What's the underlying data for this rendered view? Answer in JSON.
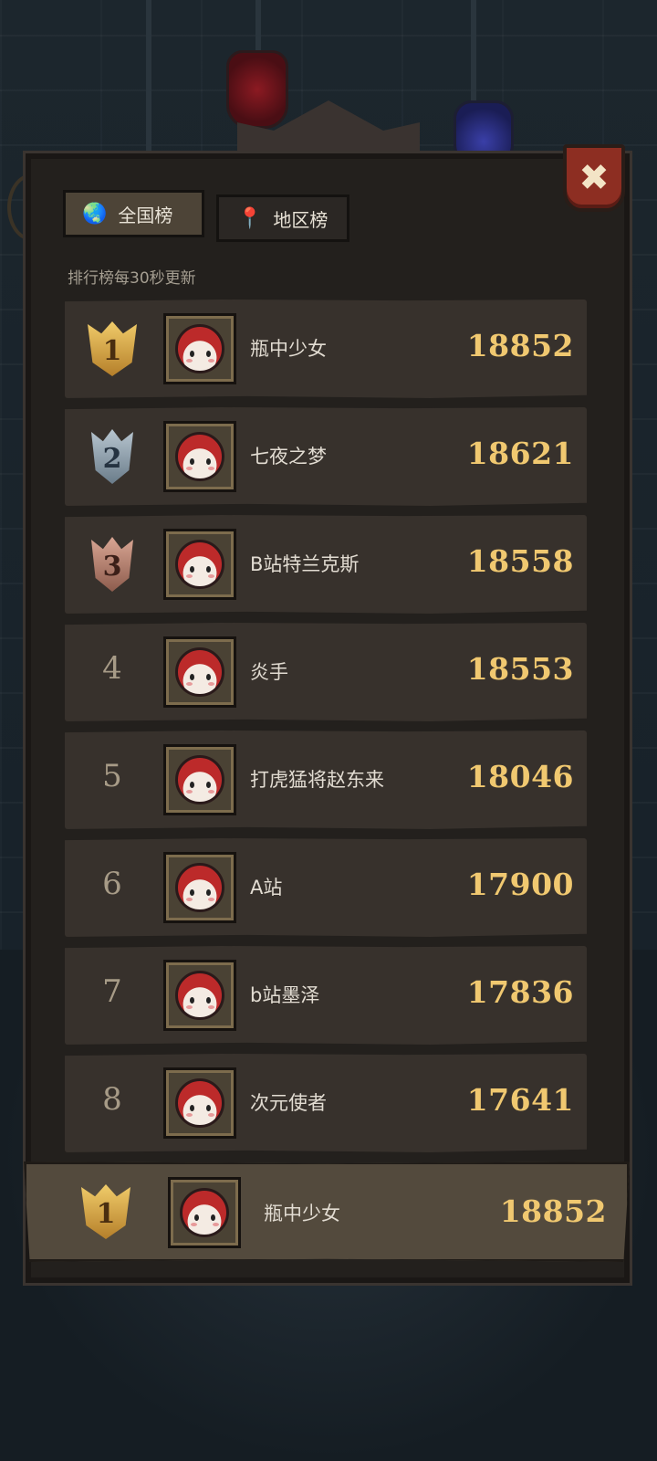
{
  "tabs": [
    {
      "label": "全国榜",
      "icon": "globe-icon",
      "selected": true
    },
    {
      "label": "地区榜",
      "icon": "location-pin-icon",
      "selected": false
    }
  ],
  "subtitle": "排行榜每30秒更新",
  "close_icon": "close-icon",
  "rows": [
    {
      "rank": "1",
      "name": "瓶中少女",
      "score": "18852"
    },
    {
      "rank": "2",
      "name": "七夜之梦",
      "score": "18621"
    },
    {
      "rank": "3",
      "name": "B站特兰克斯",
      "score": "18558"
    },
    {
      "rank": "4",
      "name": "炎手",
      "score": "18553"
    },
    {
      "rank": "5",
      "name": "打虎猛将赵东来",
      "score": "18046"
    },
    {
      "rank": "6",
      "name": "A站",
      "score": "17900"
    },
    {
      "rank": "7",
      "name": "b站墨泽",
      "score": "17836"
    },
    {
      "rank": "8",
      "name": "次元使者",
      "score": "17641"
    }
  ],
  "self": {
    "rank": "1",
    "name": "瓶中少女",
    "score": "18852"
  },
  "colors": {
    "score": "#f0c870",
    "panel": "#23201d",
    "row": "#37312c",
    "close": "#8d2e22"
  }
}
